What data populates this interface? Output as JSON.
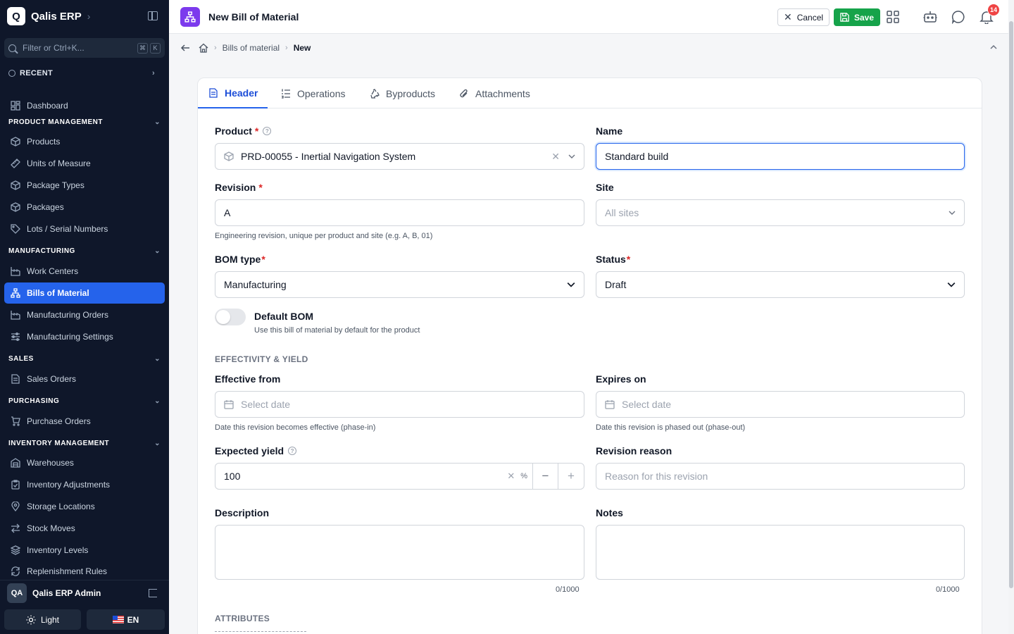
{
  "app": {
    "name": "Qalis ERP",
    "logo_letter": "Q"
  },
  "sidebar": {
    "filter_placeholder": "Filter or Ctrl+K...",
    "kbd_cmd": "⌘",
    "kbd_k": "K",
    "recent_label": "RECENT",
    "dashboard": "Dashboard",
    "sections": {
      "product": "PRODUCT MANAGEMENT",
      "manufacturing": "MANUFACTURING",
      "sales": "SALES",
      "purchasing": "PURCHASING",
      "inventory": "INVENTORY MANAGEMENT"
    },
    "items": {
      "products": "Products",
      "uom": "Units of Measure",
      "package_types": "Package Types",
      "packages": "Packages",
      "lots": "Lots / Serial Numbers",
      "work_centers": "Work Centers",
      "boms": "Bills of Material",
      "mfg_orders": "Manufacturing Orders",
      "mfg_settings": "Manufacturing Settings",
      "sales_orders": "Sales Orders",
      "purchase_orders": "Purchase Orders",
      "warehouses": "Warehouses",
      "inv_adjustments": "Inventory Adjustments",
      "storage_locations": "Storage Locations",
      "stock_moves": "Stock Moves",
      "inv_levels": "Inventory Levels",
      "replenishment": "Replenishment Rules"
    },
    "user": {
      "initials": "QA",
      "name": "Qalis ERP Admin"
    },
    "theme_label": "Light",
    "lang_label": "EN"
  },
  "topbar": {
    "title": "New Bill of Material",
    "cancel_label": "Cancel",
    "save_label": "Save",
    "notification_count": "14"
  },
  "breadcrumb": {
    "parent": "Bills of material",
    "current": "New"
  },
  "tabs": [
    "Header",
    "Operations",
    "Byproducts",
    "Attachments"
  ],
  "form": {
    "product": {
      "label": "Product",
      "value": "PRD-00055 - Inertial Navigation System"
    },
    "name": {
      "label": "Name",
      "value": "Standard build"
    },
    "revision": {
      "label": "Revision",
      "value": "A",
      "help": "Engineering revision, unique per product and site (e.g. A, B, 01)"
    },
    "site": {
      "label": "Site",
      "placeholder": "All sites"
    },
    "bom_type": {
      "label": "BOM type",
      "value": "Manufacturing"
    },
    "status": {
      "label": "Status",
      "value": "Draft"
    },
    "default_bom": {
      "label": "Default BOM",
      "desc": "Use this bill of material by default for the product"
    },
    "effectivity_section": "EFFECTIVITY & YIELD",
    "effective_from": {
      "label": "Effective from",
      "placeholder": "Select date",
      "help": "Date this revision becomes effective (phase-in)"
    },
    "expires_on": {
      "label": "Expires on",
      "placeholder": "Select date",
      "help": "Date this revision is phased out (phase-out)"
    },
    "expected_yield": {
      "label": "Expected yield",
      "value": "100",
      "unit": "%"
    },
    "revision_reason": {
      "label": "Revision reason",
      "placeholder": "Reason for this revision"
    },
    "description": {
      "label": "Description",
      "counter": "0/1000"
    },
    "notes": {
      "label": "Notes",
      "counter": "0/1000"
    },
    "attributes_section": "ATTRIBUTES"
  }
}
